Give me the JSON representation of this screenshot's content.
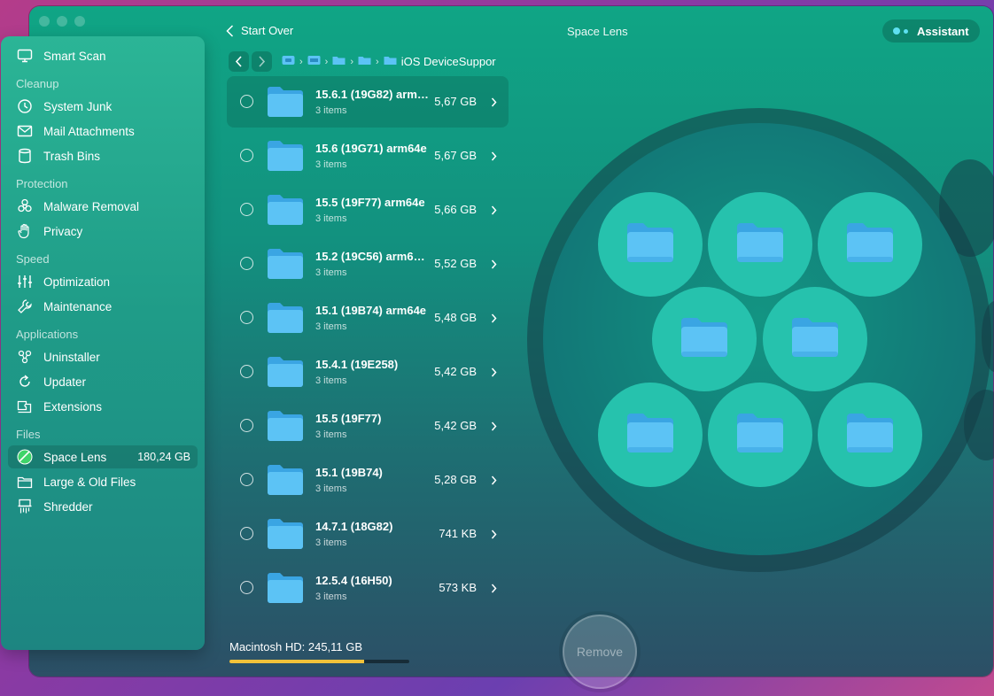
{
  "window": {
    "title": "Space Lens",
    "start_over": "Start Over",
    "assistant_label": "Assistant"
  },
  "sidebar": {
    "top_item": "Smart Scan",
    "sections": [
      {
        "title": "Cleanup",
        "items": [
          "System Junk",
          "Mail Attachments",
          "Trash Bins"
        ]
      },
      {
        "title": "Protection",
        "items": [
          "Malware Removal",
          "Privacy"
        ]
      },
      {
        "title": "Speed",
        "items": [
          "Optimization",
          "Maintenance"
        ]
      },
      {
        "title": "Applications",
        "items": [
          "Uninstaller",
          "Updater",
          "Extensions"
        ]
      },
      {
        "title": "Files",
        "items": [
          "Space Lens",
          "Large & Old Files",
          "Shredder"
        ]
      }
    ],
    "active_item": "Space Lens",
    "active_size": "180,24 GB"
  },
  "breadcrumb": {
    "current": "iOS DeviceSuppor"
  },
  "list": [
    {
      "name": "15.6.1 (19G82) arm…",
      "sub": "3 items",
      "size": "5,67 GB"
    },
    {
      "name": "15.6 (19G71) arm64e",
      "sub": "3 items",
      "size": "5,67 GB"
    },
    {
      "name": "15.5 (19F77) arm64e",
      "sub": "3 items",
      "size": "5,66 GB"
    },
    {
      "name": "15.2 (19C56) arm6…",
      "sub": "3 items",
      "size": "5,52 GB"
    },
    {
      "name": "15.1 (19B74) arm64e",
      "sub": "3 items",
      "size": "5,48 GB"
    },
    {
      "name": "15.4.1 (19E258)",
      "sub": "3 items",
      "size": "5,42 GB"
    },
    {
      "name": "15.5 (19F77)",
      "sub": "3 items",
      "size": "5,42 GB"
    },
    {
      "name": "15.1 (19B74)",
      "sub": "3 items",
      "size": "5,28 GB"
    },
    {
      "name": "14.7.1 (18G82)",
      "sub": "3 items",
      "size": "741 KB"
    },
    {
      "name": "12.5.4 (16H50)",
      "sub": "3 items",
      "size": "573 KB"
    }
  ],
  "disk": {
    "label": "Macintosh HD: 245,11 GB",
    "used_fraction": 0.75
  },
  "remove_label": "Remove",
  "colors": {
    "accent_bubble": "#26c2ad",
    "folder_blue": "#5cc3f5",
    "disk_fill": "#f2c23a"
  }
}
